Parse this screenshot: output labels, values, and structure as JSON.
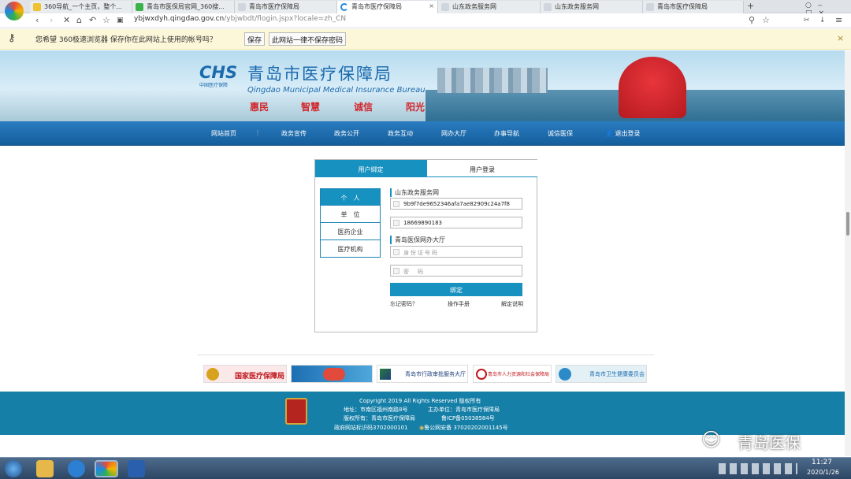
{
  "browser": {
    "tabs": [
      {
        "label": "360导航_一个主页，整个..."
      },
      {
        "label": "青岛市医保局官网_360搜..."
      },
      {
        "label": "青岛市医疗保障局"
      },
      {
        "label": "青岛市医疗保障局"
      },
      {
        "label": "山东政务服务网"
      },
      {
        "label": "山东政务服务网"
      },
      {
        "label": "青岛市医疗保障局"
      }
    ],
    "new_tab": "+",
    "url_host": "ybjwxdyh.qingdao.gov.cn",
    "url_path": "/ybjwbdt/flogin.jspx?locale=zh_CN"
  },
  "password_prompt": {
    "message": "您希望 360极速浏览器 保存你在此网站上使用的帐号吗？",
    "save_label": "保存",
    "never_label": "此网站一律不保存密码",
    "close": "×"
  },
  "banner": {
    "logo_mark": "CHS",
    "logo_sub": "中国医疗保障",
    "title_cn": "青岛市医疗保障局",
    "title_en": "Qingdao Municipal Medical Insurance Bureau",
    "slogans": [
      "惠民",
      "智慧",
      "诚信",
      "阳光"
    ]
  },
  "nav": {
    "items": [
      "网站首页",
      "政务宣传",
      "政务公开",
      "政务互动",
      "网办大厅",
      "办事导航",
      "诚信医保"
    ],
    "logout": "退出登录"
  },
  "login": {
    "tabs": {
      "bind": "用户绑定",
      "login": "用户登录"
    },
    "side": [
      "个　人",
      "单　位",
      "医药企业",
      "医疗机构"
    ],
    "section1": "山东政务服务网",
    "field1": "9b9f7de9652346afa7ae82909c24a7f8",
    "field2": "18669890183",
    "section2": "青岛医保网办大厅",
    "id_placeholder": "身份证号码",
    "pwd_placeholder": "密　码",
    "bind_button": "绑定",
    "links": {
      "forgot": "忘记密码？",
      "manual": "操作手册",
      "unbind": "解定说明"
    }
  },
  "partners": [
    "国家医疗保障局",
    "",
    "青岛市行政审批服务大厅",
    "青岛市人力资源和社会保障局",
    "青岛市卫生健康委员会"
  ],
  "footer": {
    "copyright": "Copyright 2019 All Rights Reserved 版权所有",
    "address": "地址：市南区福州南路8号",
    "sponsor": "主办单位：青岛市医疗保障局",
    "owner": "版权所有：青岛市医疗保障局",
    "icp": "鲁ICP备05038584号",
    "site_id": "政府网站标识码3702000101",
    "police": "鲁公网安备 37020202001145号"
  },
  "taskbar": {
    "time": "11:27",
    "date": "2020/1/26"
  },
  "watermark": {
    "text": "青岛医保"
  },
  "colors": {
    "nav": "#1b6aae",
    "accent": "#1791bf",
    "footer": "#157fa7",
    "banner_red": "#d2252b"
  }
}
